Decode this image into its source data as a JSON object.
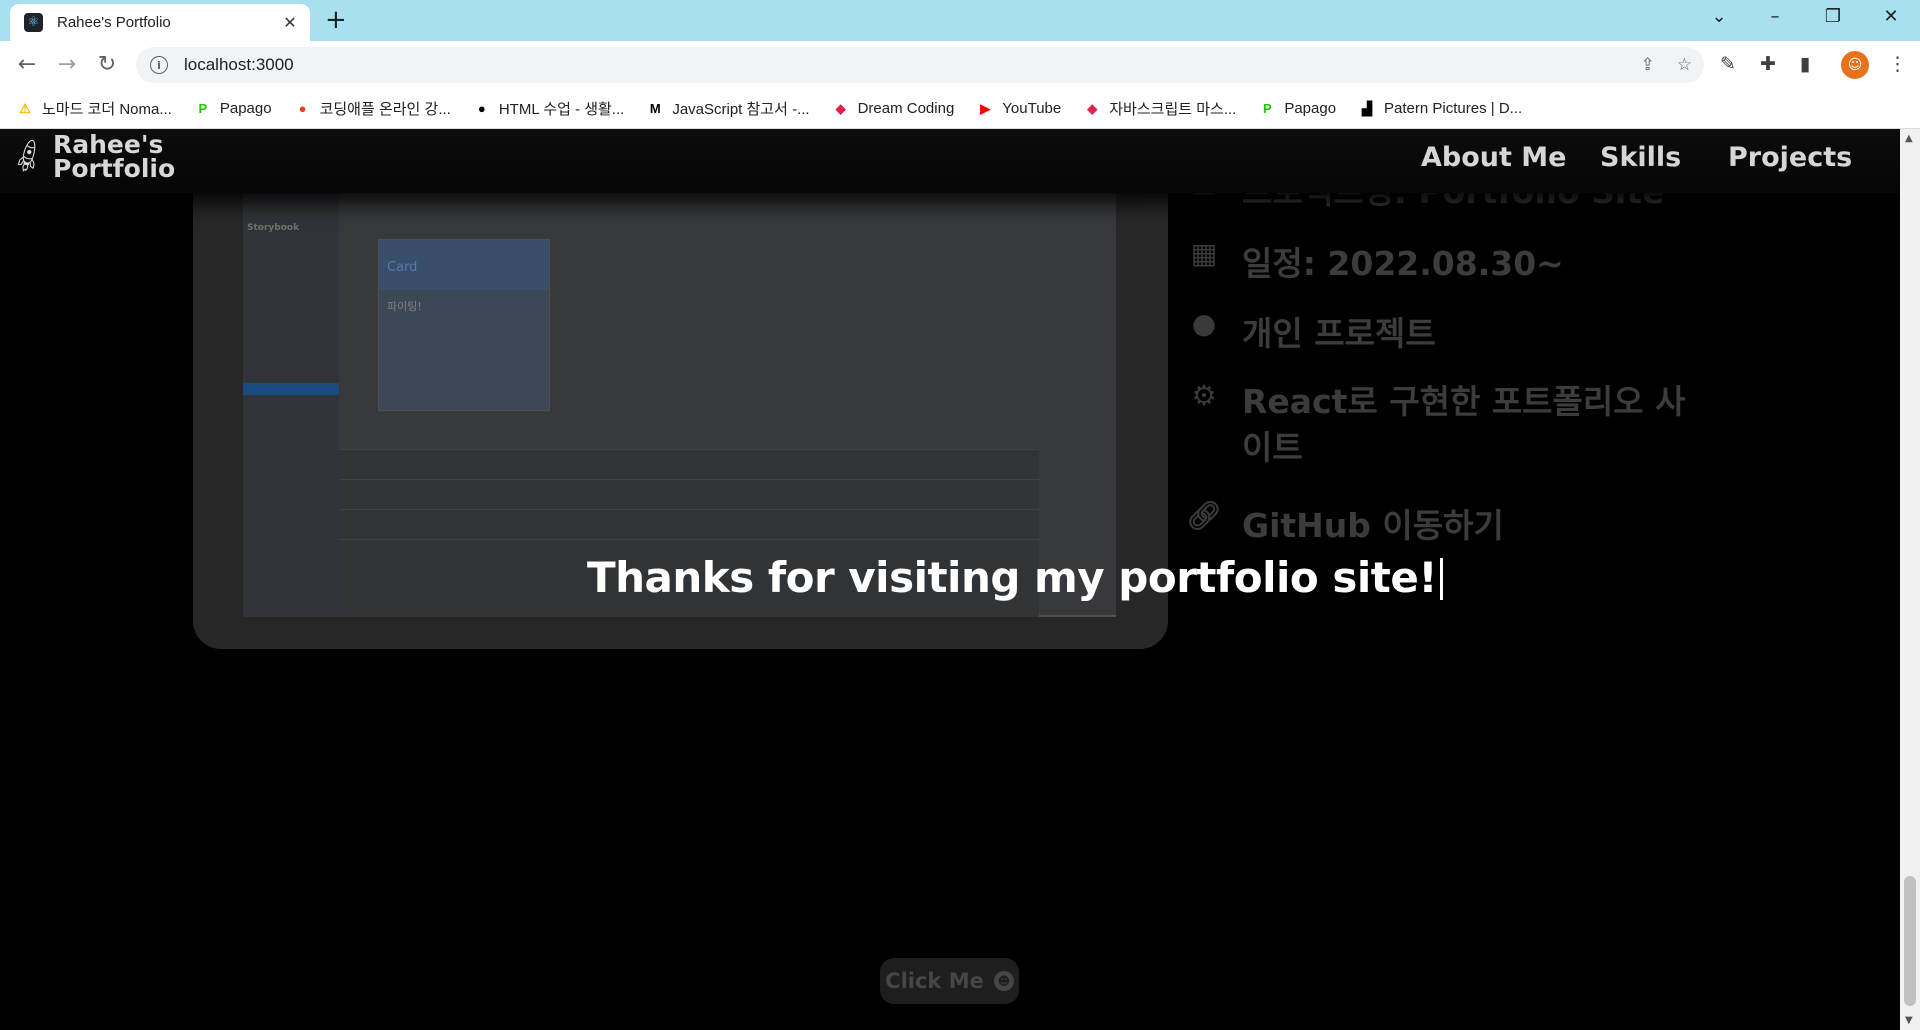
{
  "browser": {
    "tab_title": "Rahee's Portfolio",
    "tab_close": "✕",
    "new_tab": "+",
    "url": "localhost:3000",
    "bookmarks": [
      {
        "label": "노마드 코더 Noma...",
        "icon": "nomad-coders-icon",
        "glyph": "⚠",
        "color": "#f6b700"
      },
      {
        "label": "Papago",
        "icon": "papago-icon",
        "glyph": "P",
        "color": "#1ec800"
      },
      {
        "label": "코딩애플 온라인 강...",
        "icon": "apple-icon",
        "glyph": "●",
        "color": "#e2441c"
      },
      {
        "label": "HTML 수업 - 생활...",
        "icon": "circle-icon",
        "glyph": "●",
        "color": "#000000"
      },
      {
        "label": "JavaScript 참고서 -...",
        "icon": "mdn-icon",
        "glyph": "M",
        "color": "#000000"
      },
      {
        "label": "Dream Coding",
        "icon": "dream-coding-icon",
        "glyph": "◆",
        "color": "#e0234e"
      },
      {
        "label": "YouTube",
        "icon": "youtube-icon",
        "glyph": "▶",
        "color": "#ff0000"
      },
      {
        "label": "자바스크립트 마스...",
        "icon": "dream-coding-icon",
        "glyph": "◆",
        "color": "#e0234e"
      },
      {
        "label": "Papago",
        "icon": "papago-icon",
        "glyph": "P",
        "color": "#1ec800"
      },
      {
        "label": "Patern Pictures | D...",
        "icon": "patern-icon",
        "glyph": "▟",
        "color": "#000000"
      }
    ]
  },
  "site": {
    "logo_line1": "Rahee's",
    "logo_line2": "Portfolio",
    "nav": [
      "About Me",
      "Skills",
      "Projects"
    ],
    "project": {
      "partial_top": "프로젝트명: Portfolio Site",
      "date": "일정: 2022.08.30~",
      "type": "개인 프로젝트",
      "desc_line1": "React로 구현한 포트폴리오 사",
      "desc_line2": "이트",
      "github": "GitHub 이동하기",
      "screenshot_card_title": "Card",
      "screenshot_card_body": "파이팅!",
      "screenshot_sidebar_title": "Storybook"
    },
    "thanks": "Thanks for visiting my portfolio site!",
    "click_me": "Click Me"
  }
}
